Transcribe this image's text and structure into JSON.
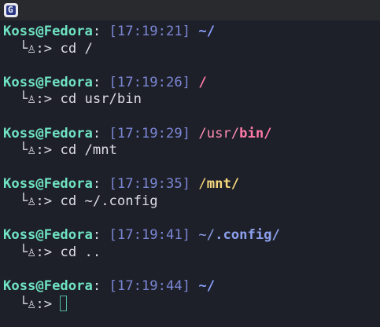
{
  "titlebar": {
    "icon": "terminal-app-icon",
    "icon_glyph": "G"
  },
  "prompt_symbol": "└♙:>",
  "entries": [
    {
      "user": "Koss@Fedora",
      "sep": ":",
      "time": "[17:19:21]",
      "path_parts": [
        {
          "text": "~/",
          "style": "home"
        }
      ],
      "command": "cd /"
    },
    {
      "user": "Koss@Fedora",
      "sep": ":",
      "time": "[17:19:26]",
      "path_parts": [
        {
          "text": "/",
          "style": "root"
        }
      ],
      "command": "cd usr/bin"
    },
    {
      "user": "Koss@Fedora",
      "sep": ":",
      "time": "[17:19:29]",
      "path_parts": [
        {
          "text": "/usr/",
          "style": "dirdim-pink"
        },
        {
          "text": "bin/",
          "style": "dirbold-pink"
        }
      ],
      "command": "cd /mnt"
    },
    {
      "user": "Koss@Fedora",
      "sep": ":",
      "time": "[17:19:35]",
      "path_parts": [
        {
          "text": "/",
          "style": "dir-yellow-dim"
        },
        {
          "text": "mnt/",
          "style": "dir-yellow"
        }
      ],
      "command": "cd ~/.config"
    },
    {
      "user": "Koss@Fedora",
      "sep": ":",
      "time": "[17:19:41]",
      "path_parts": [
        {
          "text": "~/",
          "style": "dir-blue-dim"
        },
        {
          "text": ".config/",
          "style": "dir-blue"
        }
      ],
      "command": "cd .."
    },
    {
      "user": "Koss@Fedora",
      "sep": ":",
      "time": "[17:19:44]",
      "path_parts": [
        {
          "text": "~/",
          "style": "home"
        }
      ],
      "command": ""
    }
  ],
  "colors": {
    "background": "#1e2029",
    "user": "#6fe3c2",
    "time": "#7a86d4",
    "home": "#8aa0ff",
    "pink": "#ff7aa8",
    "yellow": "#f6d77d",
    "cursor": "#4fb6a0"
  }
}
